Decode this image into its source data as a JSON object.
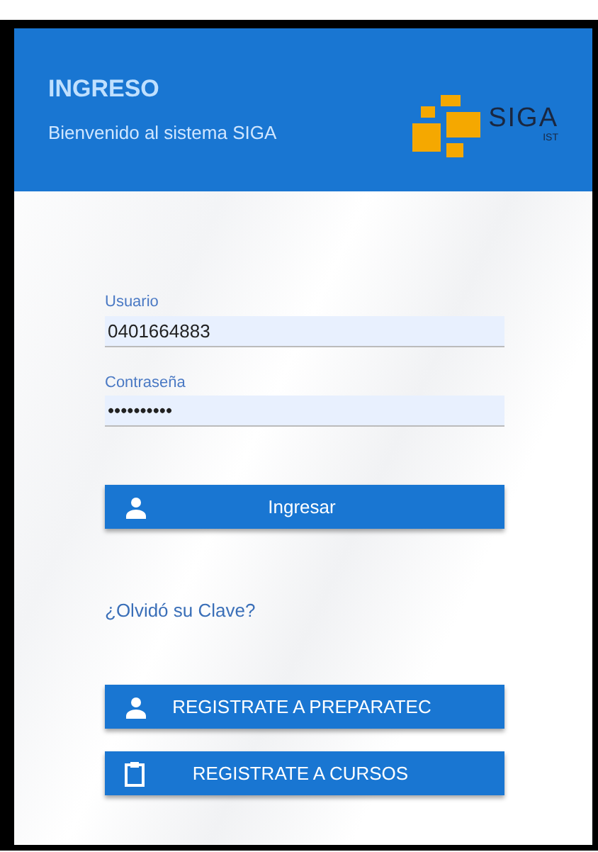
{
  "header": {
    "title": "INGRESO",
    "subtitle": "Bienvenido al sistema SIGA",
    "logo": {
      "name": "SIGA",
      "tagline": "IST"
    }
  },
  "fields": [
    {
      "label": "Usuario",
      "value": "0401664883"
    },
    {
      "label": "Contraseña",
      "value": "••••••••••"
    }
  ],
  "login_button": {
    "label": "Ingresar"
  },
  "forgot_link": "¿Olvidó su Clave?",
  "register_buttons": [
    {
      "label": "REGISTRATE A PREPARATEC",
      "kind": "person"
    },
    {
      "label": "REGISTRATE A CURSOS",
      "kind": "clipboard"
    }
  ]
}
